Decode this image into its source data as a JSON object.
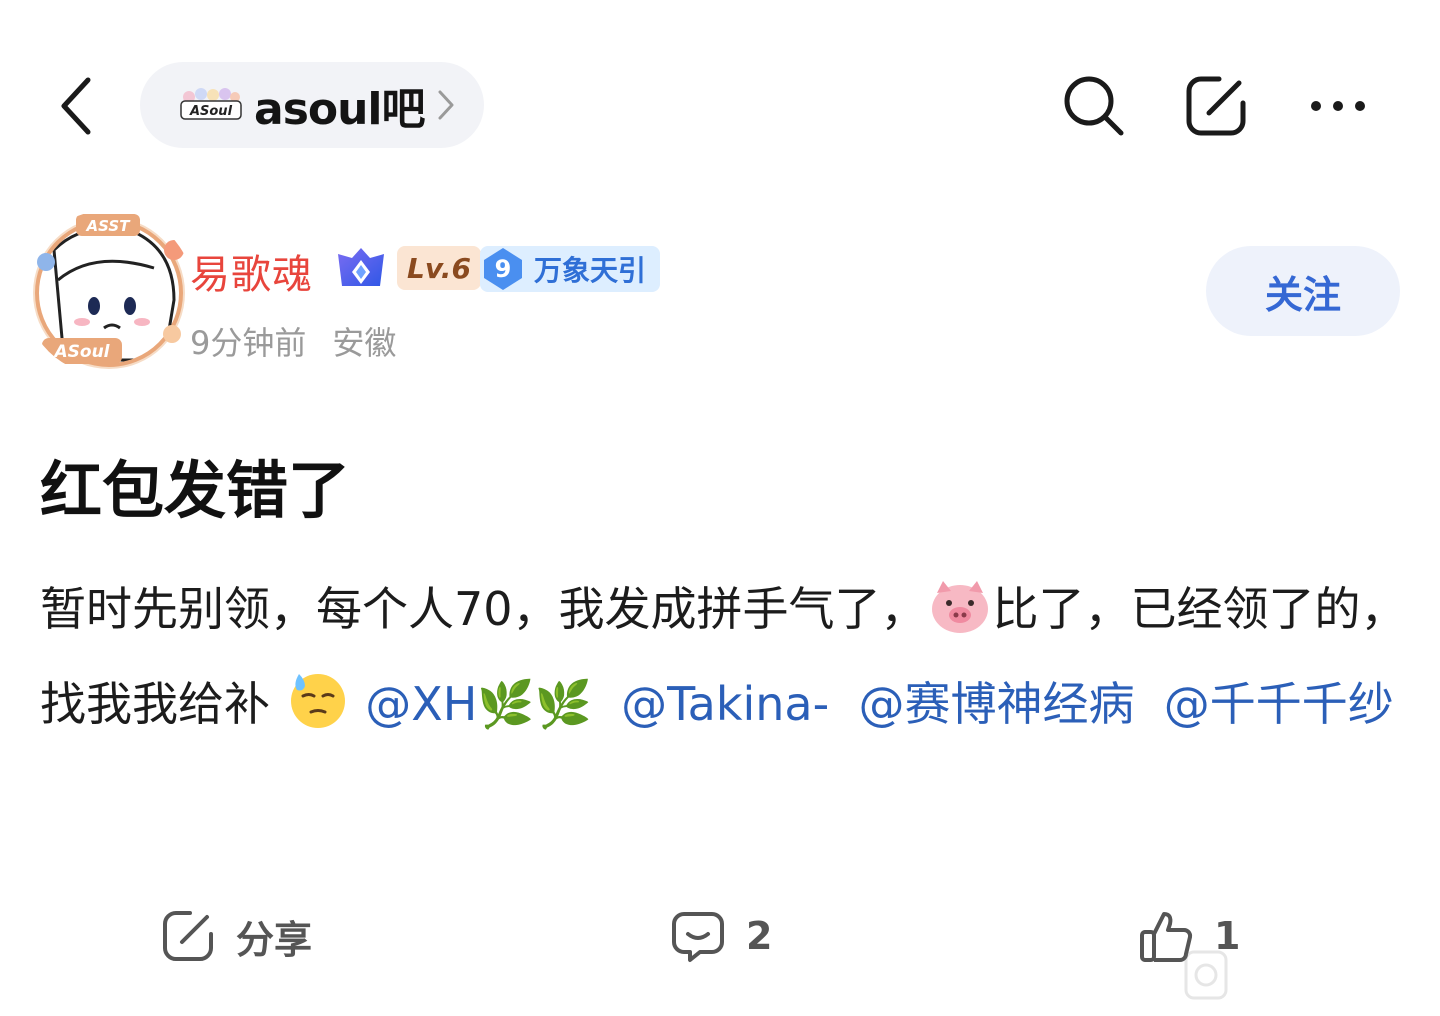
{
  "header": {
    "forum_name": "asoul吧",
    "forum_logo_text": "ASoul",
    "icons": [
      "chevron-left-icon",
      "search-icon",
      "edit-icon",
      "more-icon"
    ]
  },
  "author": {
    "name": "易歌魂",
    "level": "Lv.6",
    "title_badge_number": "9",
    "title_badge_text": "万象天引",
    "time": "9分钟前",
    "location": "安徽",
    "avatar_text_top": "ASST",
    "avatar_text_bottom": "ASoul",
    "follow_label": "关注",
    "name_color": "#e8453c"
  },
  "post": {
    "title": "红包发错了",
    "body": {
      "seg1": "暂时先别领，每个人70，我发成拼手气了，",
      "pig_emoji": "🐷",
      "seg2": "比了，已经领了的，找我我给补",
      "sweat_emoji": "😓",
      "mentions": [
        "@XH🌿🌿",
        "@Takina-",
        "@赛博神经病",
        "@千千千纱"
      ]
    },
    "mention_color": "#2b5fb8"
  },
  "actions": {
    "share_label": "分享",
    "comment_count": "2",
    "like_count": "1"
  }
}
